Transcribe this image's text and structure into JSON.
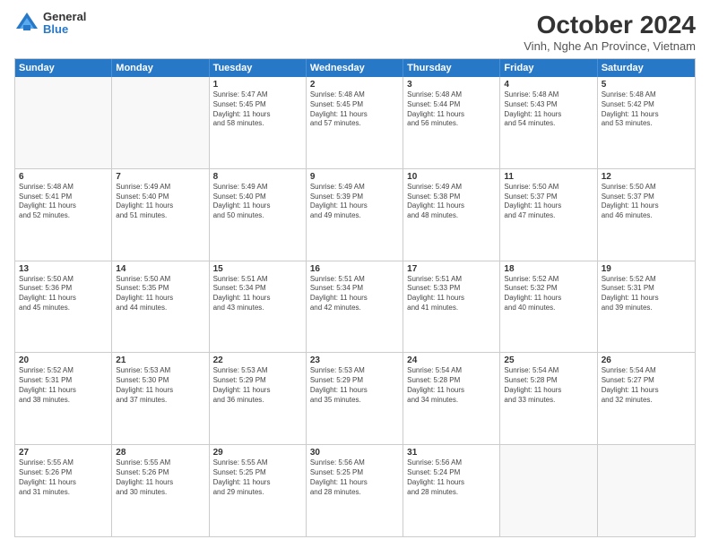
{
  "logo": {
    "general": "General",
    "blue": "Blue"
  },
  "title": "October 2024",
  "subtitle": "Vinh, Nghe An Province, Vietnam",
  "header_days": [
    "Sunday",
    "Monday",
    "Tuesday",
    "Wednesday",
    "Thursday",
    "Friday",
    "Saturday"
  ],
  "weeks": [
    [
      {
        "day": "",
        "lines": []
      },
      {
        "day": "",
        "lines": []
      },
      {
        "day": "1",
        "lines": [
          "Sunrise: 5:47 AM",
          "Sunset: 5:45 PM",
          "Daylight: 11 hours",
          "and 58 minutes."
        ]
      },
      {
        "day": "2",
        "lines": [
          "Sunrise: 5:48 AM",
          "Sunset: 5:45 PM",
          "Daylight: 11 hours",
          "and 57 minutes."
        ]
      },
      {
        "day": "3",
        "lines": [
          "Sunrise: 5:48 AM",
          "Sunset: 5:44 PM",
          "Daylight: 11 hours",
          "and 56 minutes."
        ]
      },
      {
        "day": "4",
        "lines": [
          "Sunrise: 5:48 AM",
          "Sunset: 5:43 PM",
          "Daylight: 11 hours",
          "and 54 minutes."
        ]
      },
      {
        "day": "5",
        "lines": [
          "Sunrise: 5:48 AM",
          "Sunset: 5:42 PM",
          "Daylight: 11 hours",
          "and 53 minutes."
        ]
      }
    ],
    [
      {
        "day": "6",
        "lines": [
          "Sunrise: 5:48 AM",
          "Sunset: 5:41 PM",
          "Daylight: 11 hours",
          "and 52 minutes."
        ]
      },
      {
        "day": "7",
        "lines": [
          "Sunrise: 5:49 AM",
          "Sunset: 5:40 PM",
          "Daylight: 11 hours",
          "and 51 minutes."
        ]
      },
      {
        "day": "8",
        "lines": [
          "Sunrise: 5:49 AM",
          "Sunset: 5:40 PM",
          "Daylight: 11 hours",
          "and 50 minutes."
        ]
      },
      {
        "day": "9",
        "lines": [
          "Sunrise: 5:49 AM",
          "Sunset: 5:39 PM",
          "Daylight: 11 hours",
          "and 49 minutes."
        ]
      },
      {
        "day": "10",
        "lines": [
          "Sunrise: 5:49 AM",
          "Sunset: 5:38 PM",
          "Daylight: 11 hours",
          "and 48 minutes."
        ]
      },
      {
        "day": "11",
        "lines": [
          "Sunrise: 5:50 AM",
          "Sunset: 5:37 PM",
          "Daylight: 11 hours",
          "and 47 minutes."
        ]
      },
      {
        "day": "12",
        "lines": [
          "Sunrise: 5:50 AM",
          "Sunset: 5:37 PM",
          "Daylight: 11 hours",
          "and 46 minutes."
        ]
      }
    ],
    [
      {
        "day": "13",
        "lines": [
          "Sunrise: 5:50 AM",
          "Sunset: 5:36 PM",
          "Daylight: 11 hours",
          "and 45 minutes."
        ]
      },
      {
        "day": "14",
        "lines": [
          "Sunrise: 5:50 AM",
          "Sunset: 5:35 PM",
          "Daylight: 11 hours",
          "and 44 minutes."
        ]
      },
      {
        "day": "15",
        "lines": [
          "Sunrise: 5:51 AM",
          "Sunset: 5:34 PM",
          "Daylight: 11 hours",
          "and 43 minutes."
        ]
      },
      {
        "day": "16",
        "lines": [
          "Sunrise: 5:51 AM",
          "Sunset: 5:34 PM",
          "Daylight: 11 hours",
          "and 42 minutes."
        ]
      },
      {
        "day": "17",
        "lines": [
          "Sunrise: 5:51 AM",
          "Sunset: 5:33 PM",
          "Daylight: 11 hours",
          "and 41 minutes."
        ]
      },
      {
        "day": "18",
        "lines": [
          "Sunrise: 5:52 AM",
          "Sunset: 5:32 PM",
          "Daylight: 11 hours",
          "and 40 minutes."
        ]
      },
      {
        "day": "19",
        "lines": [
          "Sunrise: 5:52 AM",
          "Sunset: 5:31 PM",
          "Daylight: 11 hours",
          "and 39 minutes."
        ]
      }
    ],
    [
      {
        "day": "20",
        "lines": [
          "Sunrise: 5:52 AM",
          "Sunset: 5:31 PM",
          "Daylight: 11 hours",
          "and 38 minutes."
        ]
      },
      {
        "day": "21",
        "lines": [
          "Sunrise: 5:53 AM",
          "Sunset: 5:30 PM",
          "Daylight: 11 hours",
          "and 37 minutes."
        ]
      },
      {
        "day": "22",
        "lines": [
          "Sunrise: 5:53 AM",
          "Sunset: 5:29 PM",
          "Daylight: 11 hours",
          "and 36 minutes."
        ]
      },
      {
        "day": "23",
        "lines": [
          "Sunrise: 5:53 AM",
          "Sunset: 5:29 PM",
          "Daylight: 11 hours",
          "and 35 minutes."
        ]
      },
      {
        "day": "24",
        "lines": [
          "Sunrise: 5:54 AM",
          "Sunset: 5:28 PM",
          "Daylight: 11 hours",
          "and 34 minutes."
        ]
      },
      {
        "day": "25",
        "lines": [
          "Sunrise: 5:54 AM",
          "Sunset: 5:28 PM",
          "Daylight: 11 hours",
          "and 33 minutes."
        ]
      },
      {
        "day": "26",
        "lines": [
          "Sunrise: 5:54 AM",
          "Sunset: 5:27 PM",
          "Daylight: 11 hours",
          "and 32 minutes."
        ]
      }
    ],
    [
      {
        "day": "27",
        "lines": [
          "Sunrise: 5:55 AM",
          "Sunset: 5:26 PM",
          "Daylight: 11 hours",
          "and 31 minutes."
        ]
      },
      {
        "day": "28",
        "lines": [
          "Sunrise: 5:55 AM",
          "Sunset: 5:26 PM",
          "Daylight: 11 hours",
          "and 30 minutes."
        ]
      },
      {
        "day": "29",
        "lines": [
          "Sunrise: 5:55 AM",
          "Sunset: 5:25 PM",
          "Daylight: 11 hours",
          "and 29 minutes."
        ]
      },
      {
        "day": "30",
        "lines": [
          "Sunrise: 5:56 AM",
          "Sunset: 5:25 PM",
          "Daylight: 11 hours",
          "and 28 minutes."
        ]
      },
      {
        "day": "31",
        "lines": [
          "Sunrise: 5:56 AM",
          "Sunset: 5:24 PM",
          "Daylight: 11 hours",
          "and 28 minutes."
        ]
      },
      {
        "day": "",
        "lines": []
      },
      {
        "day": "",
        "lines": []
      }
    ]
  ]
}
